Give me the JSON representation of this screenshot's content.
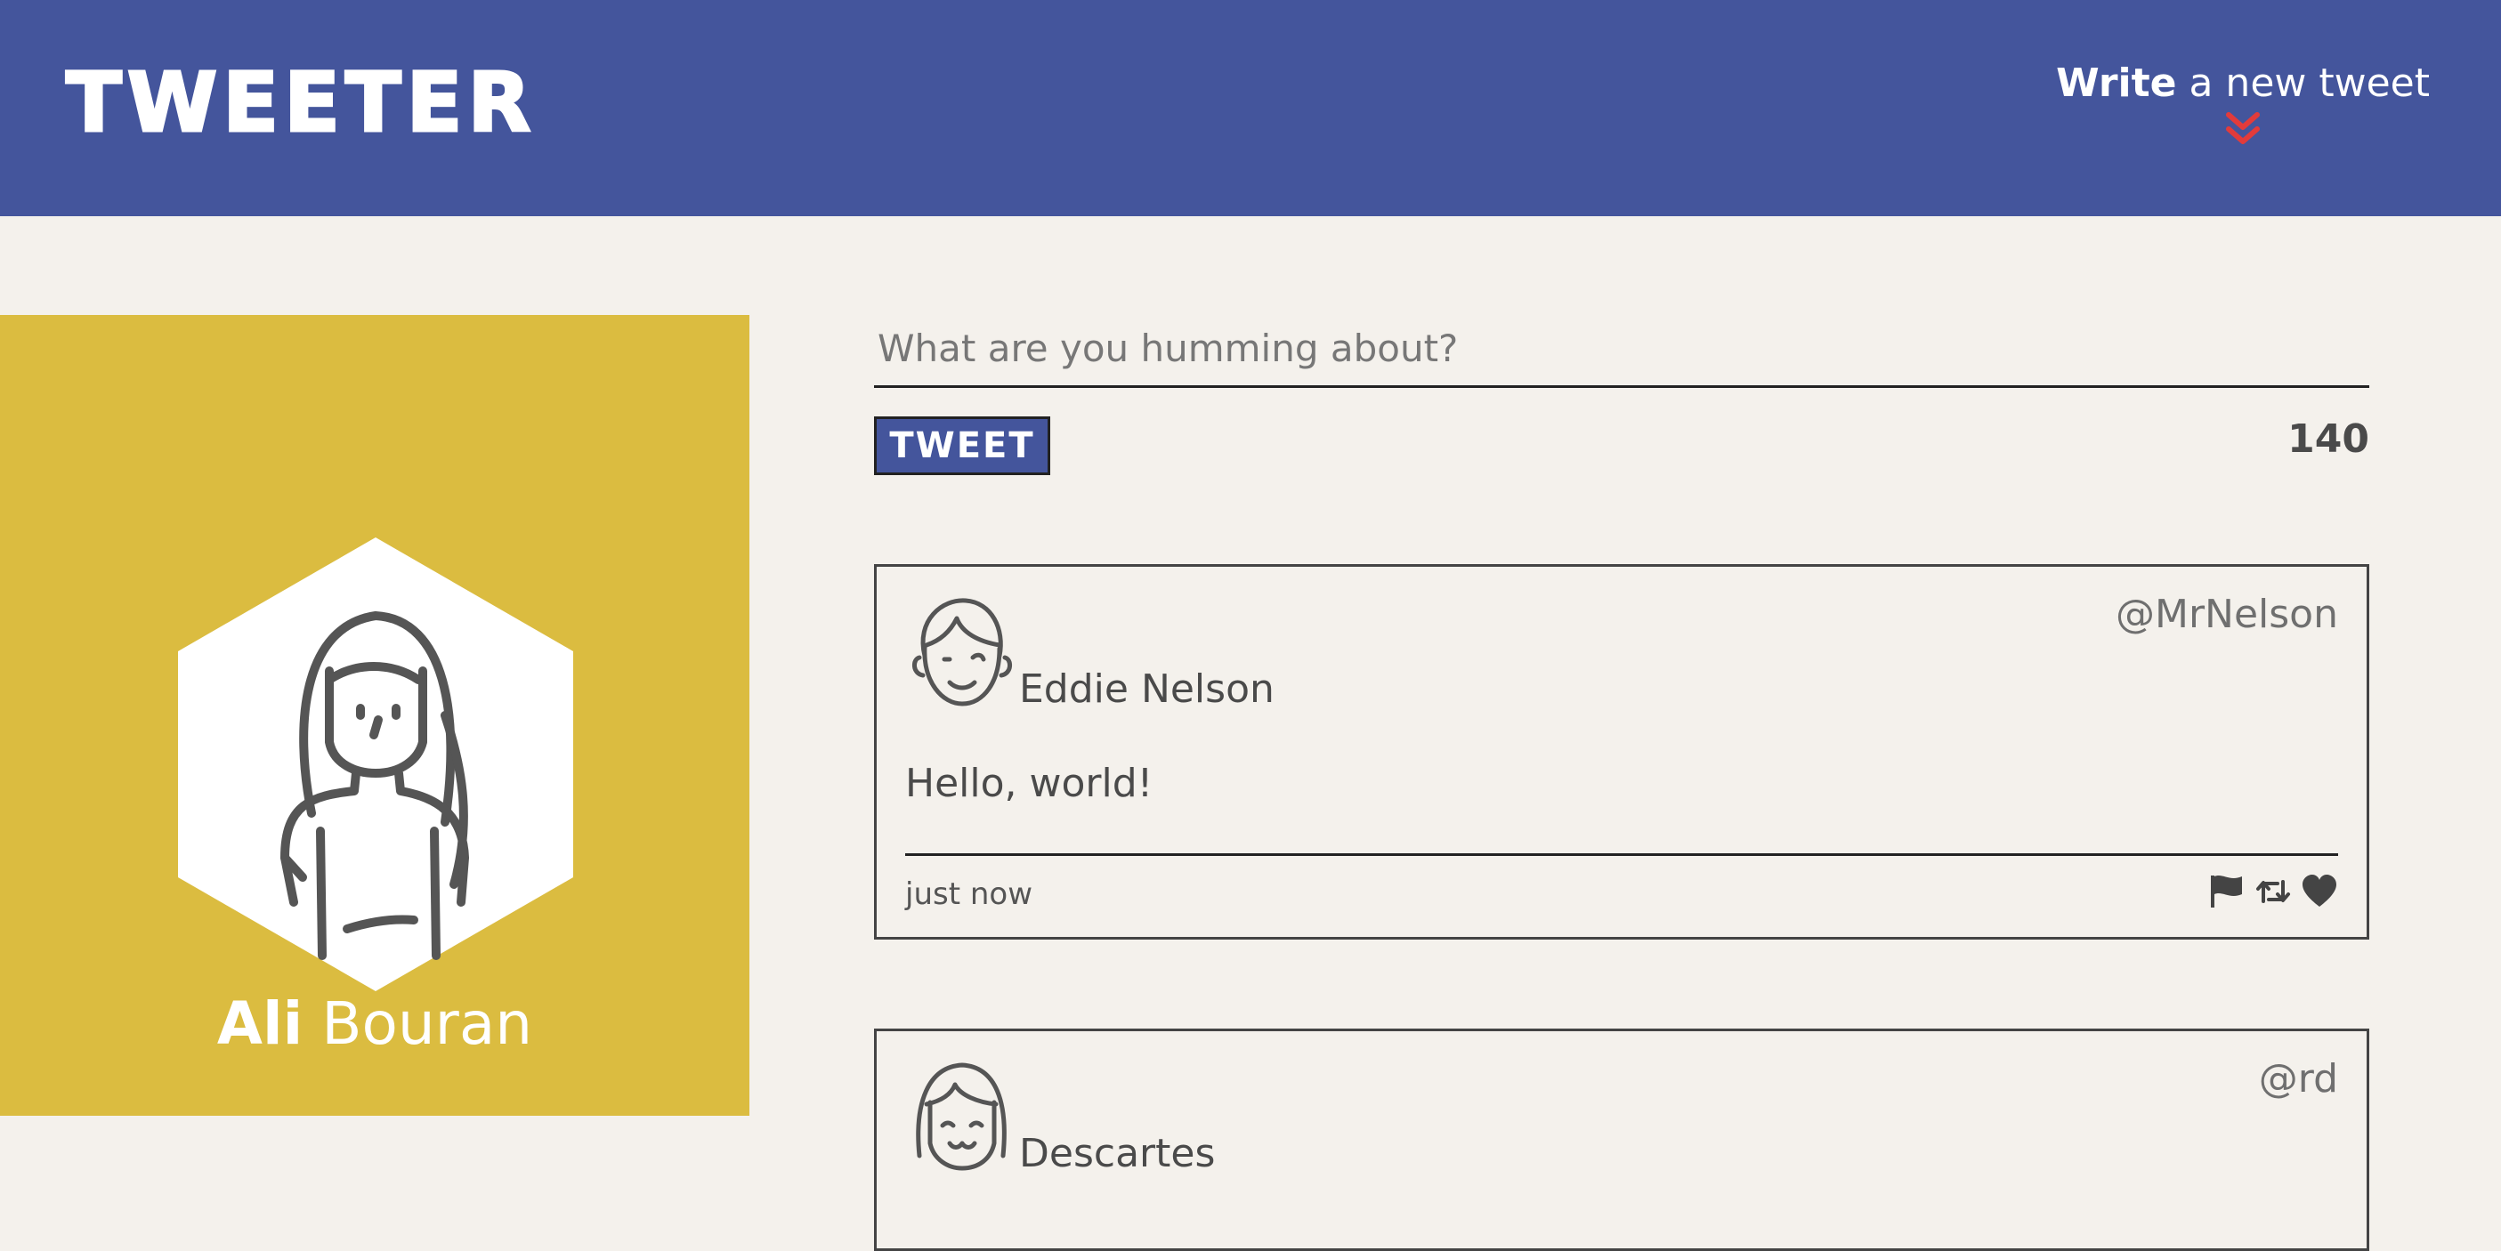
{
  "header": {
    "logo": "TWEETER",
    "compose_bold": "Write",
    "compose_rest": " a new tweet",
    "accent_color": "#44559c",
    "chevron_color": "#e23b3b"
  },
  "profile": {
    "first_name": "Ali",
    "last_name": " Bouran",
    "background_color": "#dbbc40"
  },
  "composer": {
    "placeholder": "What are you humming about?",
    "value": "",
    "button_label": "TWEET",
    "counter": "140"
  },
  "tweets": [
    {
      "display_name": "Eddie Nelson",
      "handle": "@MrNelson",
      "content": "Hello, world!",
      "timestamp": "just now",
      "actions": [
        "flag-icon",
        "retweet-icon",
        "heart-icon"
      ]
    },
    {
      "display_name": "Descartes",
      "handle": "@rd"
    }
  ]
}
